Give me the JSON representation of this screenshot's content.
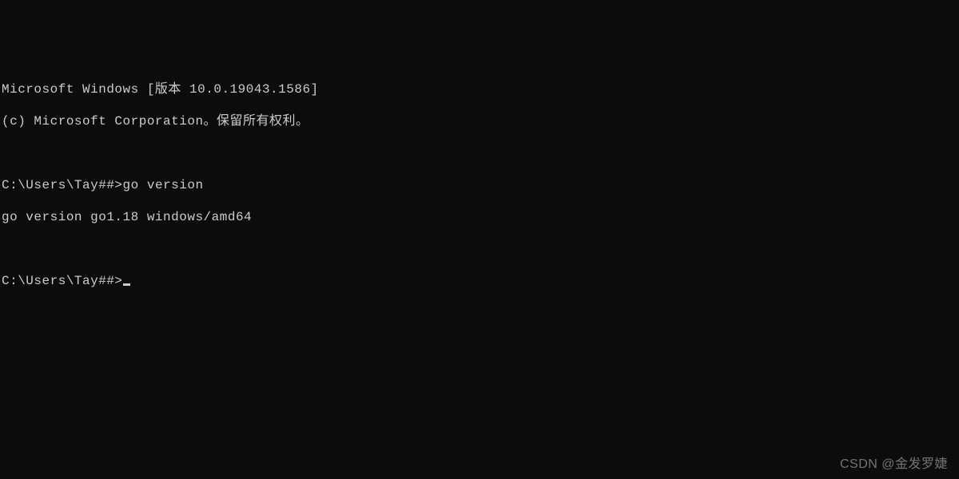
{
  "terminal": {
    "banner_line1": "Microsoft Windows [版本 10.0.19043.1586]",
    "banner_line2": "(c) Microsoft Corporation。保留所有权利。",
    "blank1": "",
    "prompt1": "C:\\Users\\Tay##>",
    "command1": "go version",
    "output1": "go version go1.18 windows/amd64",
    "blank2": "",
    "prompt2": "C:\\Users\\Tay##>"
  },
  "watermark": "CSDN @金发罗婕"
}
